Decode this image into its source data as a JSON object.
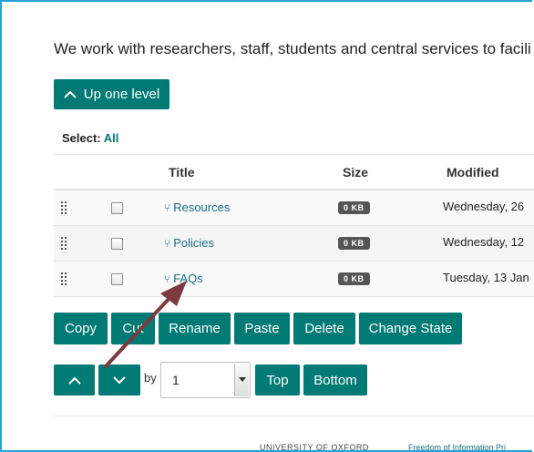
{
  "intro_text": "We work with researchers, staff, students and central services to facili",
  "up_level_label": "Up one level",
  "select": {
    "label": "Select:",
    "all": "All"
  },
  "table": {
    "headers": {
      "title": "Title",
      "size": "Size",
      "modified": "Modified"
    },
    "rows": [
      {
        "title": "Resources",
        "size": "0 KB",
        "modified": "Wednesday, 26"
      },
      {
        "title": "Policies",
        "size": "0 KB",
        "modified": "Wednesday, 12"
      },
      {
        "title": "FAQs",
        "size": "0 KB",
        "modified": "Tuesday, 13 Jan"
      }
    ]
  },
  "actions": {
    "copy": "Copy",
    "cut": "Cut",
    "rename": "Rename",
    "paste": "Paste",
    "delete": "Delete",
    "change_state": "Change State"
  },
  "reorder": {
    "by_label": "by",
    "by_value": "1",
    "top": "Top",
    "bottom": "Bottom"
  },
  "footer": {
    "university": "UNIVERSITY OF OXFORD",
    "foi": "Freedom of Information  Pri"
  },
  "colors": {
    "accent": "#007a74",
    "link": "#1a6e8a",
    "frame": "#29a0d8",
    "annotation_arrow": "#7b3a3f"
  },
  "icons": {
    "up": "chevron-up-icon",
    "down": "chevron-down-icon",
    "drag": "drag-handle-icon",
    "folder": "folder-fork-icon"
  }
}
